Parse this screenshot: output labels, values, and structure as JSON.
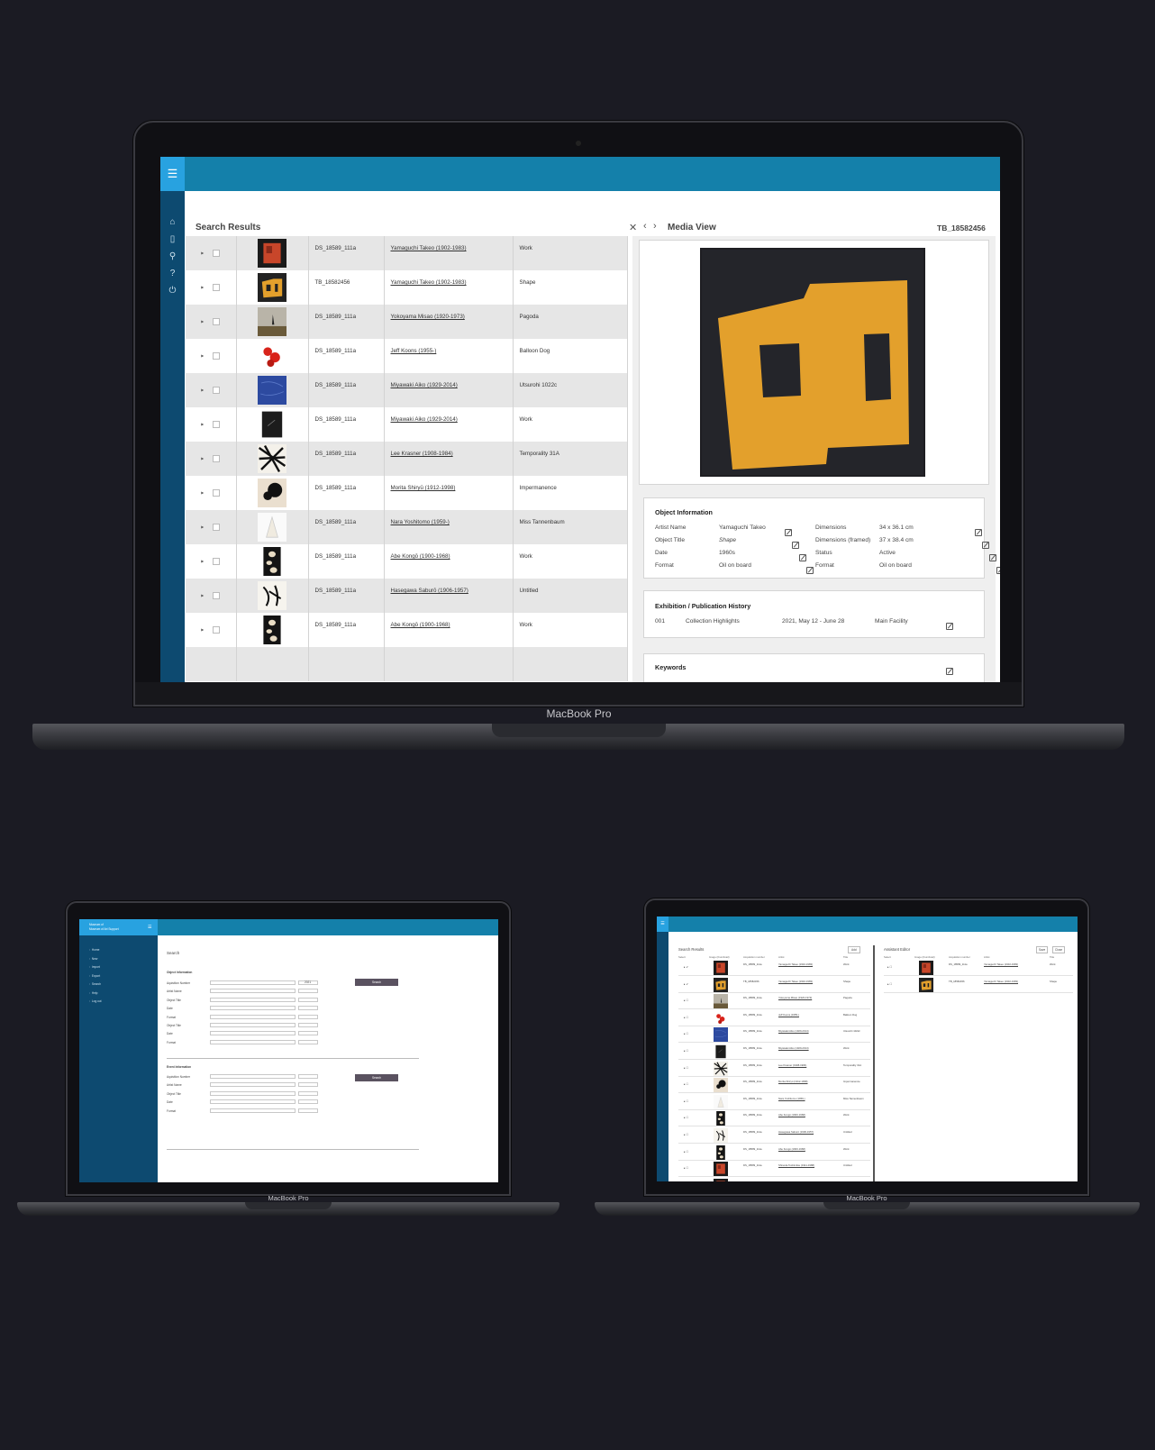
{
  "device_label": "MacBook Pro",
  "main": {
    "nav_icons": [
      "home-icon",
      "document-icon",
      "search-icon",
      "help-icon",
      "power-icon"
    ],
    "search_results_title": "Search Results",
    "media_view_title": "Media View",
    "media_id": "TB_18582456",
    "rows": [
      {
        "acq": "DS_18589_111a",
        "artist": "Yamaguchi Takeo (1902-1983)",
        "title": "Work",
        "thumb": "red-square"
      },
      {
        "acq": "TB_18582456",
        "artist": "Yamaguchi Takeo (1902-1983)",
        "title": "Shape",
        "thumb": "yellow-shape"
      },
      {
        "acq": "DS_18589_111a",
        "artist": "Yokoyama Misao (1920-1973)",
        "title": "Pagoda",
        "thumb": "landscape"
      },
      {
        "acq": "DS_18589_111a",
        "artist": "Jeff Koons (1955-)",
        "title": "Balloon Dog",
        "thumb": "balloon-dog"
      },
      {
        "acq": "DS_18589_111a",
        "artist": "Miyawaki Aiko (1929-2014)",
        "title": "Utsurohi 1022c",
        "thumb": "blue"
      },
      {
        "acq": "DS_18589_111a",
        "artist": "Miyawaki Aiko (1929-2014)",
        "title": "Work",
        "thumb": "dark"
      },
      {
        "acq": "DS_18589_111a",
        "artist": "Lee Krasner (1908-1984)",
        "title": "Temporality 31A",
        "thumb": "splatter"
      },
      {
        "acq": "DS_18589_111a",
        "artist": "Morita Shiryū (1912-1998)",
        "title": "Impermanence",
        "thumb": "ink-blot"
      },
      {
        "acq": "DS_18589_111a",
        "artist": "Nara Yoshitomo (1959-)",
        "title": "Miss Tannenbaum",
        "thumb": "cone"
      },
      {
        "acq": "DS_18589_111a",
        "artist": "Abe Kongō (1900-1968)",
        "title": "Work",
        "thumb": "ovals"
      },
      {
        "acq": "DS_18589_111a",
        "artist": "Hasegawa Saburō (1906-1957)",
        "title": "Untitled",
        "thumb": "calligraphy"
      },
      {
        "acq": "DS_18589_111a",
        "artist": "Abe Kongō (1900-1968)",
        "title": "Work",
        "thumb": "ovals"
      }
    ],
    "object_info": {
      "title": "Object Information",
      "left": [
        {
          "label": "Artist Name",
          "value": "Yamaguchi Takeo"
        },
        {
          "label": "Object Title",
          "value": "Shape"
        },
        {
          "label": "Date",
          "value": "1960s"
        },
        {
          "label": "Format",
          "value": "Oil on board"
        }
      ],
      "right": [
        {
          "label": "Dimensions",
          "value": "34 x 36.1 cm"
        },
        {
          "label": "Dimensions (framed)",
          "value": "37 x 38.4 cm"
        },
        {
          "label": "Status",
          "value": "Active"
        },
        {
          "label": "Format",
          "value": "Oil on board"
        }
      ]
    },
    "exhibition": {
      "title": "Exhibition / Publication History",
      "row": {
        "num": "001",
        "name": "Collection Highlights",
        "date": "2021, May 12 - June 28",
        "place": "Main Facility"
      }
    },
    "keywords_title": "Keywords"
  },
  "left_laptop": {
    "logo_line1": "Museum of",
    "logo_line2": "Museum of Art Support",
    "nav": [
      "Home",
      "New",
      "Import",
      "Export",
      "Search",
      "Help",
      "Log out"
    ],
    "search_title": "Search",
    "object_info_title": "Object Information",
    "object_fields": [
      "Aquisition Number",
      "Artist Name",
      "Object Title",
      "Date",
      "Format",
      "Object Title",
      "Date",
      "Format"
    ],
    "event_info_title": "Event Information",
    "event_fields": [
      "Aquisition Number",
      "Artist Name",
      "Object Title",
      "Date",
      "Format"
    ],
    "search_button": "Search",
    "year_value": "2021"
  },
  "right_laptop": {
    "search_results": "Search Results",
    "add_button": "Add",
    "assistant_editor": "Assistant Editor",
    "save_button": "Save",
    "close_button": "Close",
    "headers": [
      "Select",
      "Image (thumbnail)",
      "Acquisition number",
      "Artist",
      "Title"
    ],
    "editor_rows": [
      {
        "acq": "DS_18589_111a",
        "artist": "Yamaguchi Takeo (1902-1983)",
        "title": "Work"
      },
      {
        "acq": "TB_18582456",
        "artist": "Yamaguchi Takeo (1902-1983)",
        "title": "Shape"
      }
    ],
    "extra_rows": [
      {
        "acq": "DS_18589_111a",
        "artist": "Shinoda Toshimitsu (1911-1988)",
        "title": "Untitled"
      },
      {
        "acq": "DS_18589_111a",
        "artist": "Sugai Kumi (1919-1996)",
        "title": "Untitled"
      }
    ]
  },
  "colors": {
    "topbar": "#1480aa",
    "menu": "#28a2e0",
    "sidebar": "#0d4a70",
    "background": "#1b1b23"
  }
}
